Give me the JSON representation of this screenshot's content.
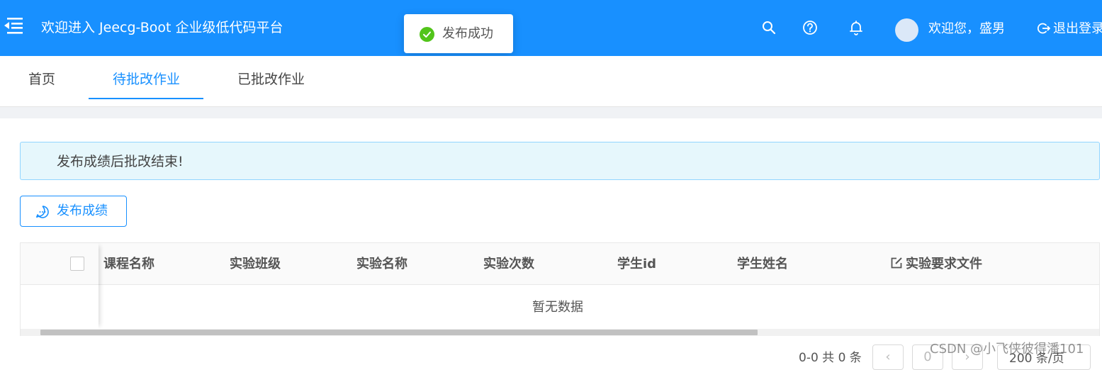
{
  "header": {
    "title": "欢迎进入 Jeecg-Boot 企业级低代码平台",
    "welcome": "欢迎您，盛男",
    "logout_label": "退出登录",
    "icons": [
      "menu-fold-icon",
      "search-icon",
      "question-circle-icon",
      "bell-icon",
      "logout-icon"
    ]
  },
  "toast": {
    "text": "发布成功",
    "icon": "check-circle-icon",
    "color": "#52c41a"
  },
  "tabs": [
    {
      "label": "首页",
      "active": false
    },
    {
      "label": "待批改作业",
      "active": true
    },
    {
      "label": "已批改作业",
      "active": false
    }
  ],
  "alert": {
    "text": "发布成绩后批改结束!"
  },
  "toolbar": {
    "publish_label": "发布成绩",
    "publish_icon": "message-icon"
  },
  "table": {
    "columns": [
      "课程名称",
      "实验班级",
      "实验名称",
      "实验次数",
      "学生id",
      "学生姓名",
      "实验要求文件"
    ],
    "empty_text": "暂无数据"
  },
  "pagination": {
    "total_text": "0-0 共 0 条",
    "current_page": "0",
    "page_size": "200 条/页"
  },
  "watermark": "CSDN @小飞侠彼得潘101",
  "colors": {
    "primary": "#1890ff",
    "success": "#52c41a",
    "alert_bg": "#e6f7fc"
  }
}
